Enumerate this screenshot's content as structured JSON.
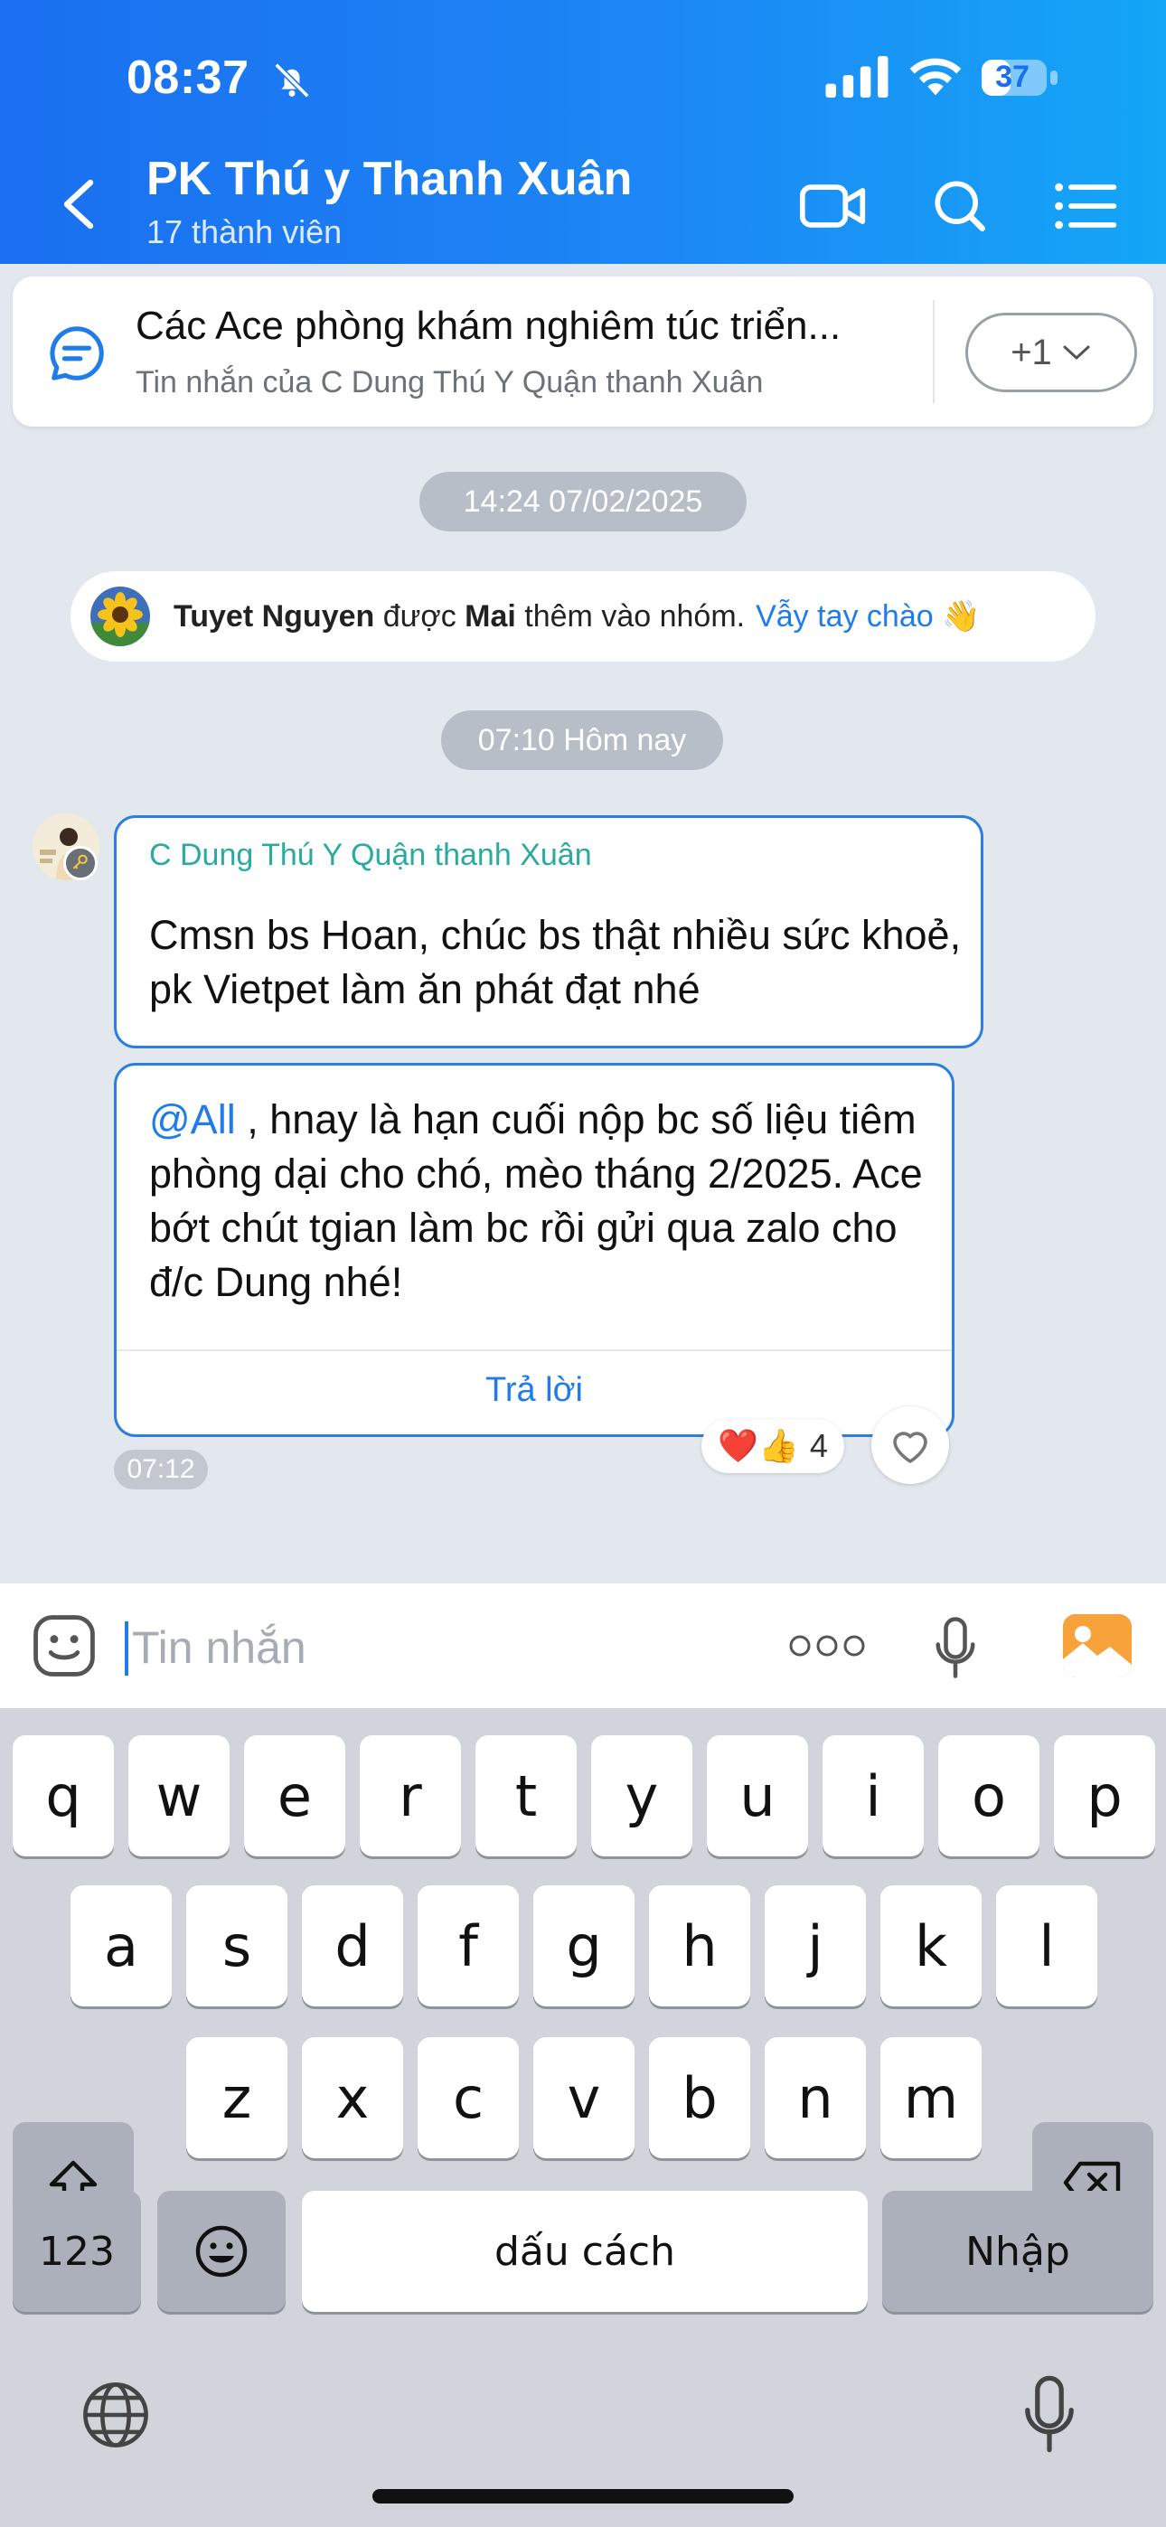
{
  "status_bar": {
    "time": "08:37",
    "battery": "37"
  },
  "header": {
    "title": "PK Thú y Thanh Xuân",
    "subtitle": "17 thành viên"
  },
  "pinned": {
    "title": "Các Ace phòng khám nghiêm túc triển...",
    "subtitle": "Tin nhắn của C Dung Thú Y Quận thanh Xuân",
    "more_label": "+1"
  },
  "timeline": {
    "chip1": "14:24 07/02/2025",
    "chip2": "07:10 Hôm nay"
  },
  "notice": {
    "name": "Tuyet Nguyen",
    "verb": "được",
    "actor": "Mai",
    "action": "thêm vào nhóm.",
    "link": "Vẫy tay chào 👋"
  },
  "messages": {
    "sender": "C Dung Thú Y Quận thanh Xuân",
    "msg1": "Cmsn bs Hoan, chúc bs thật nhiều sức khoẻ, pk Vietpet làm ăn phát đạt nhé",
    "msg2_mention": "@All",
    "msg2_text": " , hnay là hạn cuối nộp bc số liệu tiêm phòng dại cho chó, mèo tháng 2/2025. Ace bớt chút tgian làm bc rồi gửi qua zalo cho đ/c Dung nhé!",
    "reply_label": "Trả lời",
    "time": "07:12",
    "reactions": {
      "emojis": "❤️👍",
      "count": "4"
    }
  },
  "input": {
    "placeholder": "Tin nhắn"
  },
  "keyboard": {
    "row1": [
      "q",
      "w",
      "e",
      "r",
      "t",
      "y",
      "u",
      "i",
      "o",
      "p"
    ],
    "row2": [
      "a",
      "s",
      "d",
      "f",
      "g",
      "h",
      "j",
      "k",
      "l"
    ],
    "row3": [
      "z",
      "x",
      "c",
      "v",
      "b",
      "n",
      "m"
    ],
    "numbers": "123",
    "space": "dấu cách",
    "return": "Nhập"
  }
}
